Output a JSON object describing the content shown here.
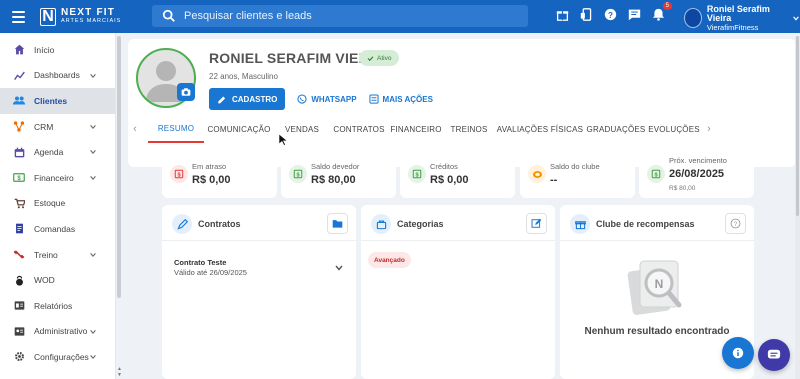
{
  "brand": {
    "line1": "NEXT FIT",
    "line2": "ARTES MARCIAIS",
    "mark": "N"
  },
  "search": {
    "placeholder": "Pesquisar clientes e leads"
  },
  "topbar": {
    "notification_count": "5",
    "user_name": "Roniel Serafim Vieira",
    "user_company": "VierafimFitness",
    "icons": [
      "gift-icon",
      "device-icon",
      "help-icon",
      "chat-icon",
      "bell-icon"
    ]
  },
  "sidebar": {
    "items": [
      {
        "label": "Início",
        "icon": "home-icon",
        "expandable": false,
        "active": false
      },
      {
        "label": "Dashboards",
        "icon": "chart-icon",
        "expandable": true,
        "active": false
      },
      {
        "label": "Clientes",
        "icon": "people-icon",
        "expandable": false,
        "active": true
      },
      {
        "label": "CRM",
        "icon": "crm-icon",
        "expandable": true,
        "active": false
      },
      {
        "label": "Agenda",
        "icon": "calendar-icon",
        "expandable": true,
        "active": false
      },
      {
        "label": "Financeiro",
        "icon": "money-icon",
        "expandable": true,
        "active": false
      },
      {
        "label": "Estoque",
        "icon": "cart-icon",
        "expandable": false,
        "active": false
      },
      {
        "label": "Comandas",
        "icon": "receipt-icon",
        "expandable": false,
        "active": false
      },
      {
        "label": "Treino",
        "icon": "dumbbell-icon",
        "expandable": true,
        "active": false
      },
      {
        "label": "WOD",
        "icon": "kettlebell-icon",
        "expandable": false,
        "active": false
      },
      {
        "label": "Relatórios",
        "icon": "report-icon",
        "expandable": false,
        "active": false
      },
      {
        "label": "Administrativo",
        "icon": "admin-icon",
        "expandable": true,
        "active": false
      },
      {
        "label": "Configurações",
        "icon": "settings-icon",
        "expandable": true,
        "active": false
      }
    ]
  },
  "profile": {
    "name": "RONIEL SERAFIM VIEIRA",
    "status": "Ativo",
    "subtitle": "22 anos, Masculino",
    "actions": {
      "cadastro": "CADASTRO",
      "whatsapp": "WHATSAPP",
      "mais": "MAIS AÇÕES"
    }
  },
  "tabs": [
    "RESUMO",
    "COMUNICAÇÃO",
    "VENDAS",
    "CONTRATOS",
    "FINANCEIRO",
    "TREINOS",
    "AVALIAÇÕES FÍSICAS",
    "GRADUAÇÕES",
    "EVOLUÇÕES"
  ],
  "active_tab": "RESUMO",
  "stats": [
    {
      "label": "Em atraso",
      "value": "R$ 0,00",
      "sub": "",
      "icon": "overdue-icon",
      "color": "#e53935",
      "bg": "#fde8e8"
    },
    {
      "label": "Saldo devedor",
      "value": "R$ 80,00",
      "sub": "",
      "icon": "debt-icon",
      "color": "#43a047",
      "bg": "#e4f3e5"
    },
    {
      "label": "Créditos",
      "value": "R$ 0,00",
      "sub": "",
      "icon": "credit-icon",
      "color": "#43a047",
      "bg": "#e4f3e5"
    },
    {
      "label": "Saldo do clube",
      "value": "--",
      "sub": "",
      "icon": "coin-icon",
      "color": "#ef8f00",
      "bg": "#fff1dc"
    },
    {
      "label": "Próx. vencimento",
      "value": "26/08/2025",
      "sub": "R$ 80,00",
      "icon": "due-icon",
      "color": "#43a047",
      "bg": "#e4f3e5"
    }
  ],
  "contracts_panel": {
    "title": "Contratos",
    "contract_name": "Contrato Teste",
    "contract_valid": "Válido até 26/09/2025"
  },
  "categories_panel": {
    "title": "Categorias",
    "chip": "Avançado"
  },
  "rewards_panel": {
    "title": "Clube de recompensas",
    "empty": "Nenhum resultado encontrado"
  }
}
